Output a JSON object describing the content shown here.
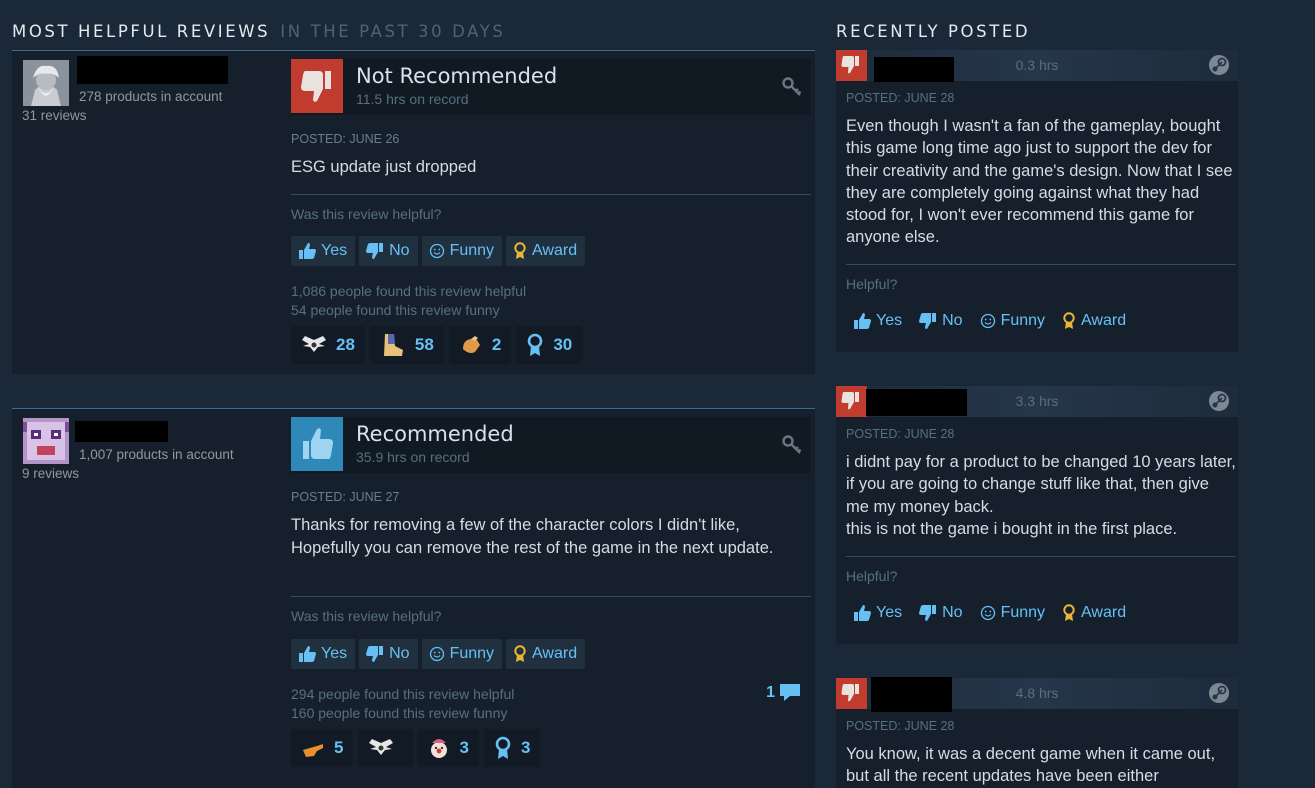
{
  "headings": {
    "main": "Most Helpful Reviews",
    "sub": "In the past 30 days",
    "recent": "Recently Posted"
  },
  "colors": {
    "background": "#1b2838",
    "panel": "#16202d",
    "accent_blue": "#66c0f4",
    "not_recommended_red": "#c13b2e",
    "recommended_blue": "#2e88b8"
  },
  "vote_labels": {
    "question": "Was this review helpful?",
    "short_question": "Helpful?",
    "yes": "Yes",
    "no": "No",
    "funny": "Funny",
    "award": "Award"
  },
  "reviews": [
    {
      "products": "278 products in account",
      "review_count": "31 reviews",
      "verdict": "Not Recommended",
      "verdict_icon": "thumbs-down-icon",
      "hours": "11.5 hrs on record",
      "posted": "Posted: June 26",
      "text": "ESG update just dropped",
      "helpful_count": "1,086 people found this review helpful",
      "funny_count": "54 people found this review funny",
      "awards": [
        {
          "icon": "winged-award-icon",
          "count": "28"
        },
        {
          "icon": "boot-award-icon",
          "count": "58"
        },
        {
          "icon": "hand-award-icon",
          "count": "2"
        },
        {
          "icon": "medal-award-icon",
          "count": "30"
        }
      ]
    },
    {
      "products": "1,007 products in account",
      "review_count": "9 reviews",
      "verdict": "Recommended",
      "verdict_icon": "thumbs-up-icon",
      "hours": "35.9 hrs on record",
      "posted": "Posted: June 27",
      "text": "Thanks for removing a few of the character colors I didn't like, Hopefully you can remove the rest of the game in the next update.",
      "helpful_count": "294 people found this review helpful",
      "funny_count": "160 people found this review funny",
      "comments": "1",
      "awards": [
        {
          "icon": "pointing-award-icon",
          "count": "5"
        },
        {
          "icon": "winged-award-icon",
          "count": ""
        },
        {
          "icon": "clown-award-icon",
          "count": "3"
        },
        {
          "icon": "medal-award-icon",
          "count": "3"
        }
      ]
    }
  ],
  "recent": [
    {
      "hours": "0.3 hrs",
      "posted": "Posted: June 28",
      "text": "Even though I wasn't a fan of the gameplay, bought this game long time ago just to support the dev for their creativity and the game's design. Now that I see they are completely going against what they had stood for, I won't ever recommend this game for anyone else."
    },
    {
      "hours": "3.3 hrs",
      "posted": "Posted: June 28",
      "text_lines": [
        "i didnt pay for a product to be changed 10 years later, if you are going to change stuff like that, then give me my money back.",
        "this is not the game i bought in the first place."
      ]
    },
    {
      "hours": "4.8 hrs",
      "posted": "Posted: June 28",
      "text": "You know, it was a decent game when it came out, but all the recent updates have been either"
    }
  ]
}
